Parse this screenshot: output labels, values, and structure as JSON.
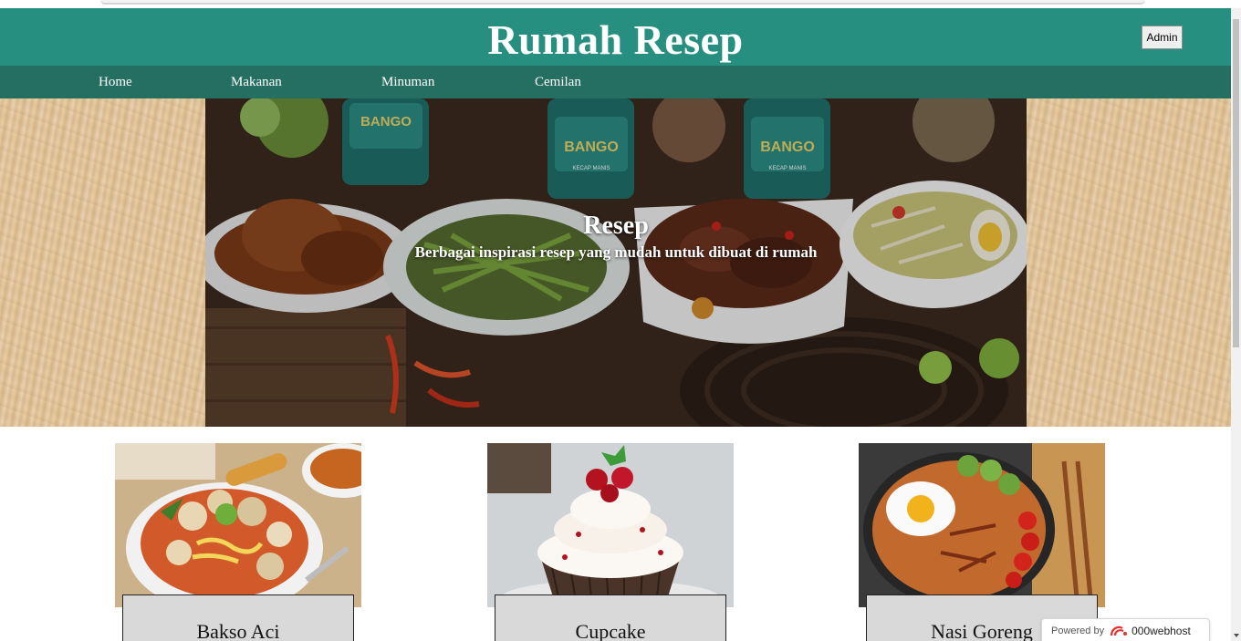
{
  "header": {
    "site_title": "Rumah Resep",
    "admin_label": "Admin"
  },
  "nav": {
    "items": [
      "Home",
      "Makanan",
      "Minuman",
      "Cemilan"
    ]
  },
  "hero": {
    "title": "Resep",
    "subtitle": "Berbagai inspirasi resep yang mudah untuk dibuat di rumah",
    "bottle_label": "BANGO"
  },
  "cards": [
    {
      "name": "Bakso Aci"
    },
    {
      "name": "Cupcake"
    },
    {
      "name": "Nasi Goreng"
    }
  ],
  "badge": {
    "powered_by": "Powered by",
    "brand": "000webhost"
  },
  "colors": {
    "header_bg": "#278f7f",
    "nav_bg": "#246f62",
    "card_label_bg": "#d9d9d9"
  }
}
